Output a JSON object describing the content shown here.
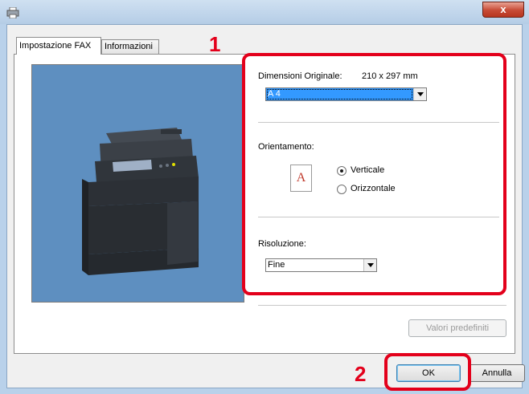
{
  "window": {
    "title": "",
    "close_glyph": "x"
  },
  "tabs": [
    {
      "label": "Impostazione FAX",
      "active": true
    },
    {
      "label": "Informazioni",
      "active": false
    }
  ],
  "settings": {
    "original_size": {
      "label": "Dimensioni Originale:",
      "dimensions": "210 x 297 mm",
      "selected": "A 4"
    },
    "orientation": {
      "label": "Orientamento:",
      "icon_letter": "A",
      "options": [
        {
          "label": "Verticale",
          "checked": true
        },
        {
          "label": "Orizzontale",
          "checked": false
        }
      ]
    },
    "resolution": {
      "label": "Risoluzione:",
      "selected": "Fine"
    },
    "defaults_button": "Valori predefiniti"
  },
  "buttons": {
    "ok": "OK",
    "cancel": "Annulla"
  },
  "annotations": {
    "callout_1": "1",
    "callout_2": "2",
    "color": "#e3001b"
  },
  "icons": [
    "printer-app-icon",
    "close-icon",
    "dropdown-arrow-icon",
    "orientation-portrait-icon",
    "mfp-printer-illustration"
  ]
}
